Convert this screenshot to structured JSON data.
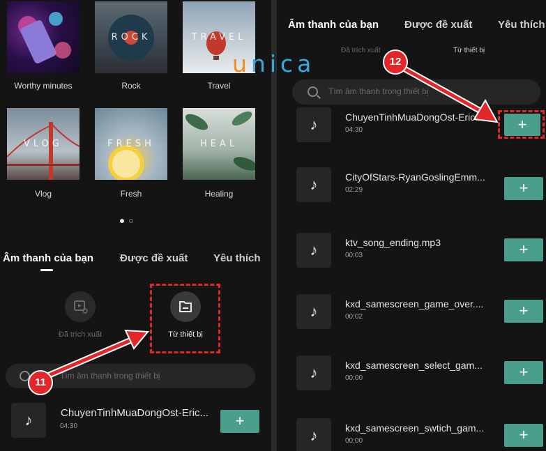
{
  "left": {
    "albums": [
      {
        "label": "Worthy minutes",
        "word": ""
      },
      {
        "label": "Rock",
        "word": "ROCK"
      },
      {
        "label": "Travel",
        "word": "TRAVEL"
      },
      {
        "label": "Vlog",
        "word": "VLOG"
      },
      {
        "label": "Fresh",
        "word": "FRESH"
      },
      {
        "label": "Healing",
        "word": "HEAL"
      }
    ],
    "tabs": [
      "Âm thanh của bạn",
      "Được đề xuất",
      "Yêu thích"
    ],
    "sources": {
      "extracted": "Đã trích xuất",
      "device": "Từ thiết bị"
    },
    "search_placeholder": "Tìm âm thanh trong thiết bị",
    "track": {
      "name": "ChuyenTinhMuaDongOst-Eric...",
      "duration": "04:30"
    },
    "step_badge": "11"
  },
  "right": {
    "tabs": [
      "Âm thanh của bạn",
      "Được đề xuất",
      "Yêu thích"
    ],
    "subtabs": [
      "Đã trích xuất",
      "Từ thiết bị"
    ],
    "search_placeholder": "Tìm âm thanh trong thiết bị",
    "tracks": [
      {
        "name": "ChuyenTinhMuaDongOst-Eric...",
        "duration": "04:30"
      },
      {
        "name": "CityOfStars-RyanGoslingEmm...",
        "duration": "02:29"
      },
      {
        "name": "ktv_song_ending.mp3",
        "duration": "00:03"
      },
      {
        "name": "kxd_samescreen_game_over....",
        "duration": "00:02"
      },
      {
        "name": "kxd_samescreen_select_gam...",
        "duration": "00:00"
      },
      {
        "name": "kxd_samescreen_swtich_gam...",
        "duration": "00:00"
      }
    ],
    "add_label": "+",
    "step_badge": "12"
  },
  "logo": {
    "chars": [
      "u",
      "n",
      "i",
      "c",
      "a"
    ]
  },
  "colors": {
    "accent_add": "#4a9e8c",
    "highlight_red": "#e3262a",
    "background": "#141414"
  },
  "icons": {
    "note": "♪",
    "music_note": "music-note-icon"
  }
}
